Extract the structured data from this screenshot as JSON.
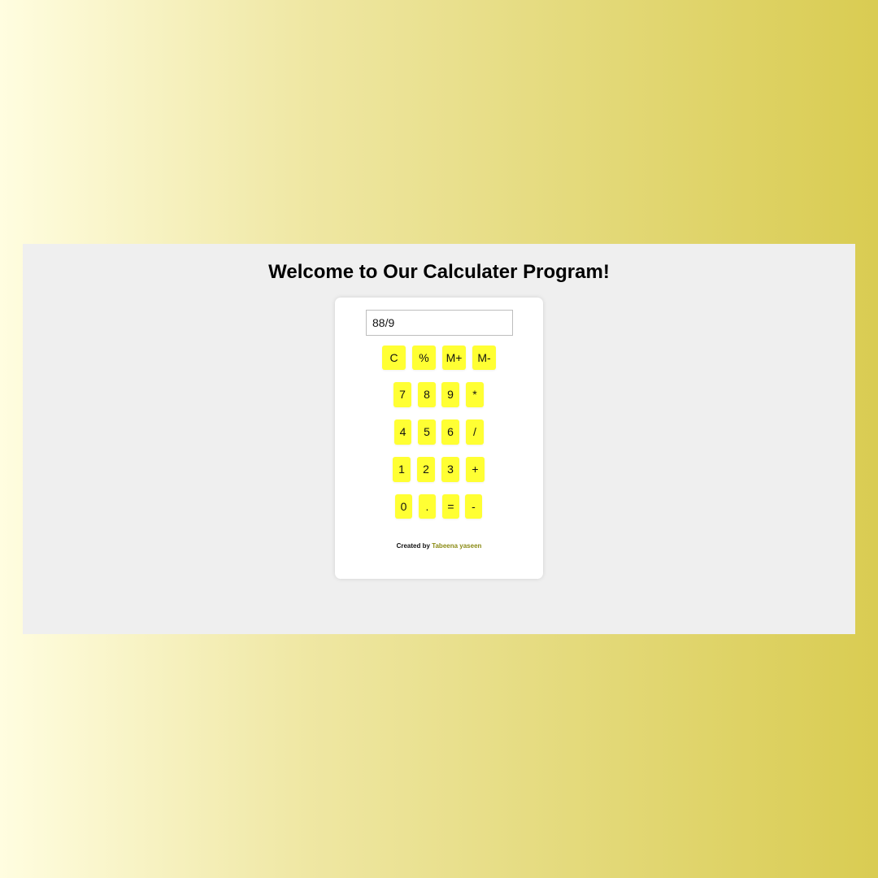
{
  "page": {
    "title": "Welcome to Our Calculater Program!"
  },
  "calculator": {
    "display_value": "88/9",
    "rows": [
      [
        "C",
        "%",
        "M+",
        "M-"
      ],
      [
        "7",
        "8",
        "9",
        "*"
      ],
      [
        "4",
        "5",
        "6",
        "/"
      ],
      [
        "1",
        "2",
        "3",
        "+"
      ],
      [
        "0",
        ".",
        "=",
        "-"
      ]
    ],
    "credit_prefix": "Created by",
    "credit_name": "Tabeena yaseen"
  },
  "colors": {
    "button_bg": "#ffff33",
    "credit_name": "#8b8b15",
    "panel_bg": "#efefef"
  }
}
